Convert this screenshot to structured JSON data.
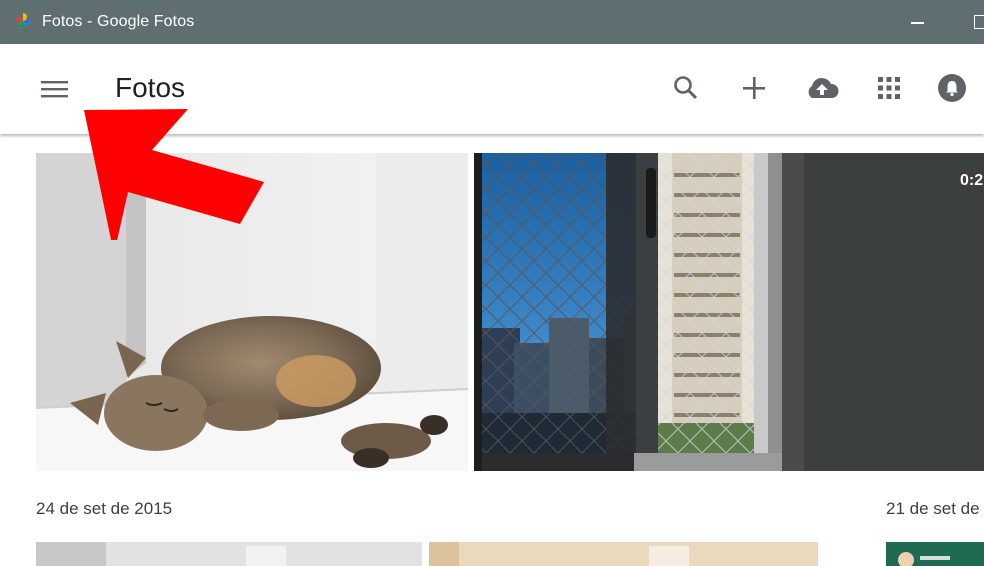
{
  "window": {
    "title": "Fotos - Google Fotos"
  },
  "appbar": {
    "title": "Fotos",
    "menu_icon": "menu-icon",
    "actions": [
      "search-icon",
      "add-icon",
      "upload-icon",
      "apps-icon",
      "notifications-icon"
    ]
  },
  "photos": {
    "video_duration": "0:2",
    "groups": [
      {
        "date": "24 de set de 2015"
      },
      {
        "date": "21 de set de"
      }
    ]
  },
  "colors": {
    "titlebar": "#5f6e71",
    "icon": "#5f6368",
    "annotation_arrow": "#ff0000"
  }
}
